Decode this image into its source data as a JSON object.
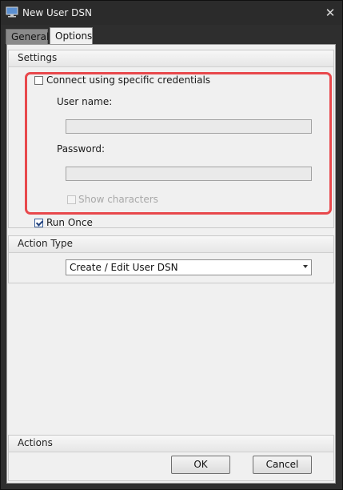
{
  "window": {
    "title": "New User DSN"
  },
  "tabs": [
    {
      "label": "General",
      "active": false
    },
    {
      "label": "Options",
      "active": true
    }
  ],
  "settings": {
    "header": "Settings",
    "connect_label": "Connect using specific credentials",
    "connect_checked": false,
    "username_label": "User name:",
    "username_value": "",
    "password_label": "Password:",
    "password_value": "",
    "show_chars_label": "Show characters",
    "show_chars_checked": false,
    "run_once_label": "Run Once",
    "run_once_checked": true
  },
  "action_type": {
    "header": "Action Type",
    "selected": "Create / Edit User DSN"
  },
  "actions": {
    "header": "Actions",
    "ok_label": "OK",
    "cancel_label": "Cancel"
  },
  "colors": {
    "highlight": "#e8484c",
    "titlebar": "#2b2b2b",
    "panel": "#f0f0f0"
  },
  "icons": [
    "computer-monitor-icon",
    "close-icon",
    "dropdown-arrow-icon",
    "checkmark-icon"
  ]
}
